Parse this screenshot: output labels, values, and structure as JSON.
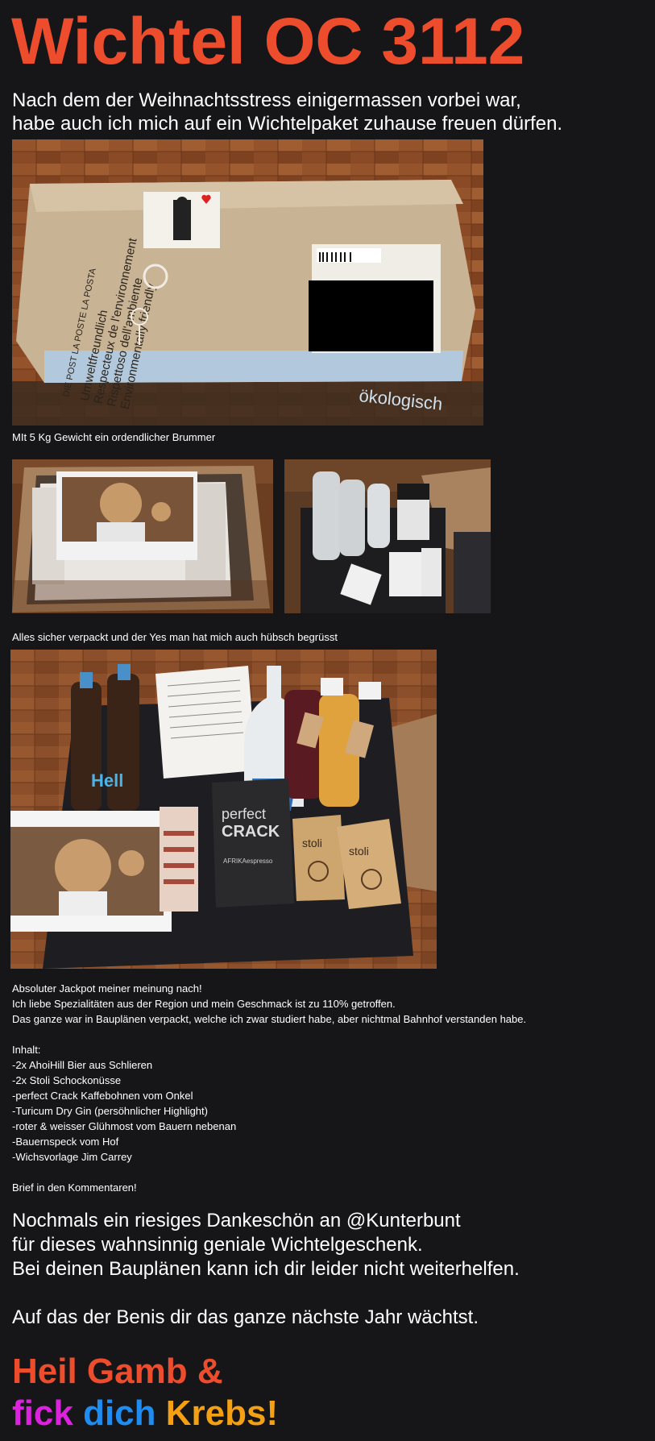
{
  "title": "Wichtel OC 3112",
  "intro": {
    "line1": "Nach dem der Weihnachtsstress einigermassen vorbei war,",
    "line2": "habe auch ich mich auf ein Wichtelpaket zuhause freuen dürfen."
  },
  "caption1": "MIt 5 Kg Gewicht ein ordendlicher Brummer",
  "caption2": "Alles sicher verpackt und der Yes man hat mich auch hübsch begrüsst",
  "box_label": {
    "line1": "DIE POST  LA POSTE  LA POSTA",
    "line2": "Umweltfreundlich",
    "line3": "Respecteux de l'environnement",
    "line4": "Rispettoso dell'ambiente",
    "line5": "Environmentally friendly",
    "bottom": "ökologisch"
  },
  "product_labels": {
    "perfect": "perfect",
    "crack": "CRACK",
    "afrika": "AFRIKAespresso",
    "hell": "Hell",
    "stoli": "stoli"
  },
  "body": {
    "p1_line1": "Absoluter Jackpot meiner meinung nach!",
    "p1_line2": "Ich liebe Spezialitäten aus der Region und mein Geschmack ist zu 110% getroffen.",
    "p1_line3": "Das ganze war in Bauplänen verpackt, welche ich zwar studiert habe, aber nichtmal Bahnhof verstanden habe.",
    "inhalt_heading": "Inhalt:",
    "items": [
      "-2x AhoiHill Bier aus Schlieren",
      "-2x Stoli Schockonüsse",
      "-perfect Crack Kaffebohnen vom Onkel",
      "-Turicum Dry Gin (persöhnlicher Highlight)",
      "-roter & weisser Glühmost vom Bauern nebenan",
      "-Bauernspeck vom Hof",
      "-Wichsvorlage Jim Carrey"
    ],
    "brief": "Brief in den Kommentaren!"
  },
  "thanks": {
    "line1": "Nochmals ein riesiges Dankeschön an @Kunterbunt",
    "line2": "für dieses wahnsinnig geniale Wichtelgeschenk.",
    "line3": "Bei deinen Bauplänen kann ich dir leider nicht weiterhelfen.",
    "line4": "Auf das der Benis dir das ganze nächste Jahr wächtst."
  },
  "closing": {
    "line1": "Heil Gamb &",
    "word1": "fick",
    "word2": "dich",
    "word3": "Krebs!"
  },
  "colors": {
    "accent": "#ee4d2d",
    "magenta": "#dd22dd",
    "blue": "#1e8cf0",
    "orange": "#f5a012",
    "background": "#161618"
  }
}
